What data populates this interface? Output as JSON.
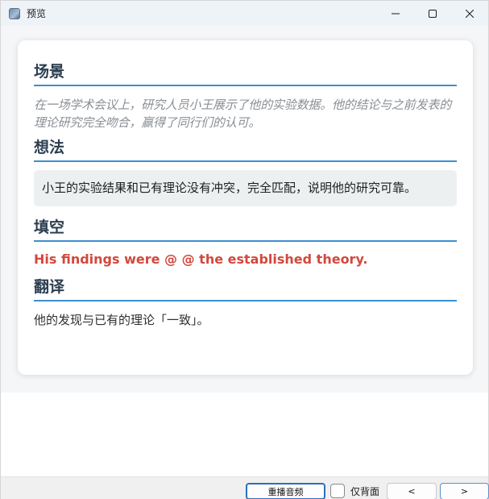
{
  "window": {
    "title": "预览",
    "icon": "app-icon",
    "controls": [
      "minimize-icon",
      "maximize-icon",
      "close-icon"
    ]
  },
  "card": {
    "scene": {
      "title": "场景",
      "text": "在一场学术会议上，研究人员小王展示了他的实验数据。他的结论与之前发表的理论研究完全吻合，赢得了同行们的认可。"
    },
    "idea": {
      "title": "想法",
      "text": "小王的实验结果和已有理论没有冲突，完全匹配，说明他的研究可靠。"
    },
    "blank": {
      "title": "填空",
      "text": "His findings were @ @ the established theory."
    },
    "translation": {
      "title": "翻译",
      "text": "他的发现与已有的理论「一致」。"
    }
  },
  "footer": {
    "replay_label": "重播音频",
    "back_only_label": "仅背面",
    "back_only_checked": false,
    "prev_label": "<",
    "next_label": ">"
  },
  "colors": {
    "accent_underline": "#3b8fd1",
    "blank_text": "#d2483c",
    "heading": "#2c3e50"
  }
}
